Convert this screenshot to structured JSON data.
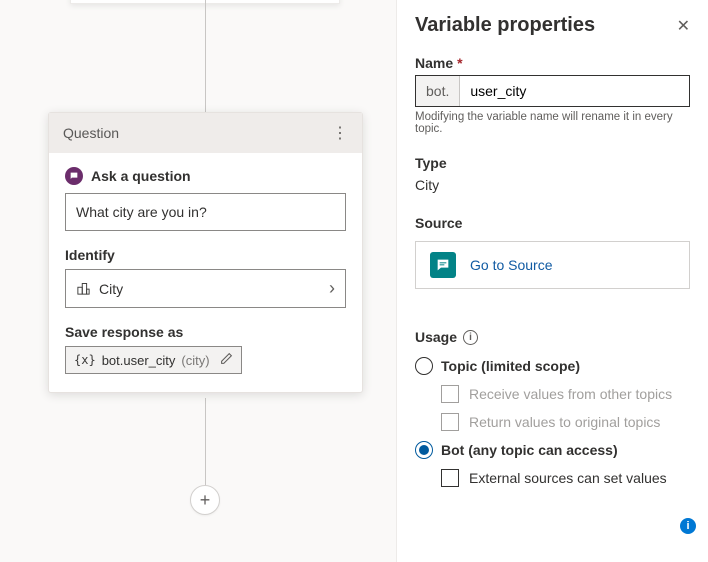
{
  "card": {
    "header": "Question",
    "ask_label": "Ask a question",
    "question_text": "What city are you in?",
    "identify_label": "Identify",
    "identify_value": "City",
    "save_label": "Save response as",
    "var_prefix": "{x}",
    "var_name": "bot.user_city",
    "var_type": "(city)"
  },
  "panel": {
    "title": "Variable properties",
    "name_label": "Name",
    "name_prefix": "bot.",
    "name_value": "user_city",
    "name_helper": "Modifying the variable name will rename it in every topic.",
    "type_label": "Type",
    "type_value": "City",
    "source_label": "Source",
    "source_link": "Go to Source",
    "usage_label": "Usage",
    "radio_topic": "Topic (limited scope)",
    "check_receive": "Receive values from other topics",
    "check_return": "Return values to original topics",
    "radio_bot": "Bot (any topic can access)",
    "check_external": "External sources can set values"
  }
}
